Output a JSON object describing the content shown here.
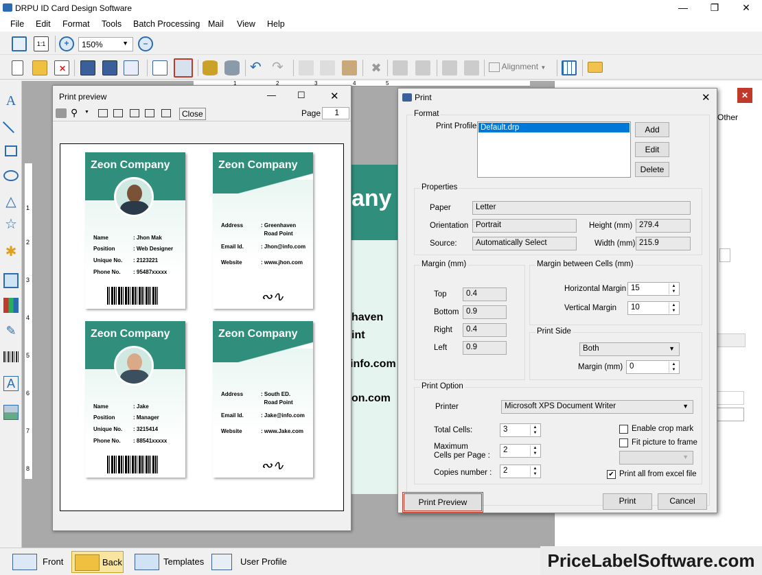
{
  "app": {
    "title": "DRPU ID Card Design Software"
  },
  "menu": [
    "File",
    "Edit",
    "Format",
    "Tools",
    "Batch Processing",
    "Mail",
    "View",
    "Help"
  ],
  "toolbar": {
    "zoom_value": "150%",
    "one_to_one": "1:1",
    "alignment_label": "Alignment"
  },
  "bg_card": {
    "text1": "any",
    "text2": "haven",
    "text3": "int",
    "text4": "info.com",
    "text5": "on.com"
  },
  "right_panel": {
    "tab_other": "Other"
  },
  "ruler": {
    "h": [
      "1",
      "2",
      "3",
      "4",
      "5"
    ],
    "v": [
      "1",
      "2",
      "3",
      "4",
      "5",
      "6",
      "7",
      "8"
    ]
  },
  "preview": {
    "title": "Print preview",
    "close_label": "Close",
    "page_label": "Page",
    "page_value": "1",
    "cards": [
      {
        "company": "Zeon Company",
        "side": "front",
        "rows": [
          {
            "k": "Name",
            "v": "Jhon Mak"
          },
          {
            "k": "Position",
            "v": "Web Designer"
          },
          {
            "k": "Unique No.",
            "v": "2123221"
          },
          {
            "k": "Phone No.",
            "v": "95487xxxxx"
          }
        ]
      },
      {
        "company": "Zeon Company",
        "side": "back",
        "rows": [
          {
            "k": "Address",
            "v": "Greenhaven"
          },
          {
            "k": "",
            "v": "Road Point"
          },
          {
            "k": "Email Id.",
            "v": "Jhon@info.com"
          },
          {
            "k": "Website",
            "v": "www.jhon.com"
          }
        ]
      },
      {
        "company": "Zeon Company",
        "side": "front",
        "rows": [
          {
            "k": "Name",
            "v": "Jake"
          },
          {
            "k": "Position",
            "v": "Manager"
          },
          {
            "k": "Unique No.",
            "v": "3215414"
          },
          {
            "k": "Phone No.",
            "v": "88541xxxxx"
          }
        ]
      },
      {
        "company": "Zeon Company",
        "side": "back",
        "rows": [
          {
            "k": "Address",
            "v": "South ED."
          },
          {
            "k": "",
            "v": "Road Point"
          },
          {
            "k": "Email Id.",
            "v": "Jake@info.com"
          },
          {
            "k": "Website",
            "v": "www.Jake.com"
          }
        ]
      }
    ]
  },
  "print": {
    "title": "Print",
    "format_label": "Format",
    "print_profile_label": "Print Profile",
    "profile_item": "Default.drp",
    "add": "Add",
    "edit": "Edit",
    "delete": "Delete",
    "properties_label": "Properties",
    "paper_label": "Paper",
    "paper_value": "Letter",
    "orientation_label": "Orientation",
    "orientation_value": "Portrait",
    "source_label": "Source:",
    "source_value": "Automatically Select",
    "height_label": "Height (mm)",
    "height_value": "279.4",
    "width_label": "Width (mm)",
    "width_value": "215.9",
    "margin_label": "Margin (mm)",
    "top_label": "Top",
    "top_value": "0.4",
    "bottom_label": "Bottom",
    "bottom_value": "0.9",
    "right_label": "Right",
    "right_value": "0.4",
    "left_label": "Left",
    "left_value": "0.9",
    "cells_margin_label": "Margin between Cells (mm)",
    "hmargin_label": "Horizontal Margin",
    "hmargin_value": "15",
    "vmargin_label": "Vertical Margin",
    "vmargin_value": "10",
    "print_side_label": "Print Side",
    "print_side_value": "Both",
    "side_margin_label": "Margin (mm)",
    "side_margin_value": "0",
    "print_option_label": "Print Option",
    "printer_label": "Printer",
    "printer_value": "Microsoft XPS Document Writer",
    "total_cells_label": "Total Cells:",
    "total_cells_value": "3",
    "max_cells_label1": "Maximum",
    "max_cells_label2": "Cells per Page :",
    "max_cells_value": "2",
    "copies_label": "Copies number :",
    "copies_value": "2",
    "crop_label": "Enable crop mark",
    "crop_checked": false,
    "fit_label": "Fit picture to frame",
    "fit_checked": false,
    "excel_label": "Print all from excel file",
    "excel_checked": true,
    "preview_btn": "Print Preview",
    "print_btn": "Print",
    "cancel_btn": "Cancel"
  },
  "status": {
    "front": "Front",
    "back": "Back",
    "templates": "Templates",
    "user_profile": "User Profile"
  },
  "brand": "PriceLabelSoftware.com"
}
